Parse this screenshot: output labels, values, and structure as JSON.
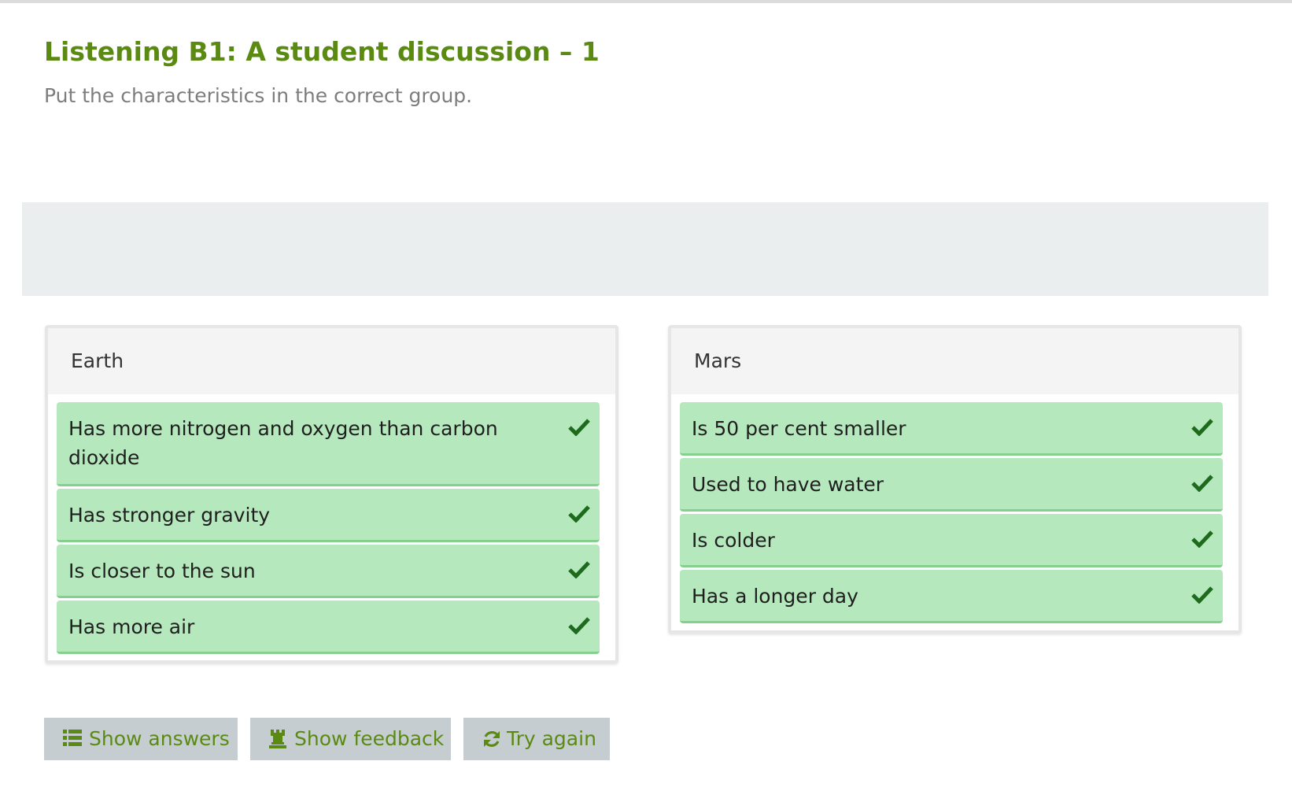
{
  "header": {
    "title": "Listening B1: A student discussion – 1",
    "instruction": "Put the characteristics in the correct group."
  },
  "groups": [
    {
      "label": "Earth",
      "items": [
        {
          "text": "Has more nitrogen and oxygen than carbon dioxide",
          "status": "correct"
        },
        {
          "text": "Has stronger gravity",
          "status": "correct"
        },
        {
          "text": "Is closer to the sun",
          "status": "correct"
        },
        {
          "text": "Has more air",
          "status": "correct"
        }
      ]
    },
    {
      "label": "Mars",
      "items": [
        {
          "text": "Is 50 per cent smaller",
          "status": "correct"
        },
        {
          "text": "Used to have water",
          "status": "correct"
        },
        {
          "text": "Is colder",
          "status": "correct"
        },
        {
          "text": "Has a longer day",
          "status": "correct"
        }
      ]
    }
  ],
  "buttons": {
    "show_answers": "Show answers",
    "show_feedback": "Show feedback",
    "try_again": "Try again"
  },
  "icons": {
    "correct": "check-icon",
    "show_answers": "list-icon",
    "show_feedback": "trophy-icon",
    "try_again": "refresh-icon"
  },
  "colors": {
    "title": "#5b8a13",
    "item_background": "#b5e8bc",
    "item_border": "#86d08f",
    "check": "#1f6b1e",
    "button_background": "#c5cdd1",
    "button_text": "#5b8a13",
    "pool_background": "#eaeeee"
  }
}
